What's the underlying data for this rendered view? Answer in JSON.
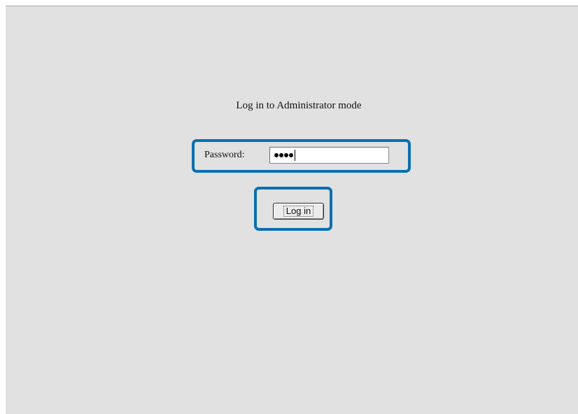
{
  "page": {
    "heading": "Log in to Administrator mode"
  },
  "password_field": {
    "label": "Password:",
    "masked_length": 4
  },
  "login_button": {
    "label": "Log in"
  },
  "colors": {
    "background": "#e1e1e1",
    "highlight": "#0a6fb3"
  }
}
